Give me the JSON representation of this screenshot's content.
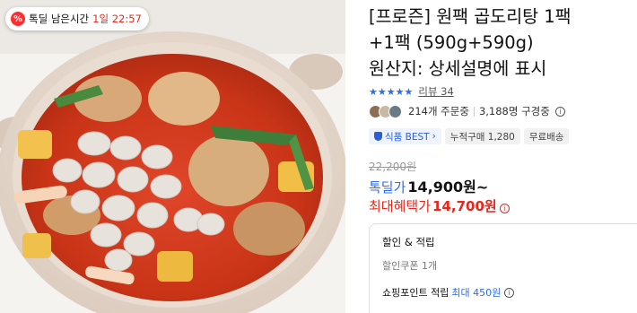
{
  "deal_timer": {
    "icon": "percent-icon",
    "label": "톡딜 남은시간",
    "remaining": "1일 22:57"
  },
  "product": {
    "title_line1": "[프로즌] 원팩 곱도리탕 1팩",
    "title_line2": "+1팩 (590g+590g)",
    "title_line3": "원산지: 상세설명에 표시",
    "rating_stars": "★★★★★",
    "review_label": "리뷰 34",
    "order_count": "214개 주문중",
    "viewers": "3,188명 구경중",
    "badges": {
      "best": "식품 BEST",
      "best_arrow": "›",
      "cumulative": "누적구매 1,280",
      "shipping": "무료배송"
    }
  },
  "pricing": {
    "original_price": "22,200원",
    "deal_label": "톡딜가",
    "deal_price": "14,900원~",
    "max_label": "최대혜택가",
    "max_price": "14,700원"
  },
  "benefits": {
    "title": "할인 & 적립",
    "coupon": "할인쿠폰 1개",
    "points_label": "쇼핑포인트 적립",
    "points_value": "최대 450원"
  },
  "colors": {
    "accent_blue": "#2a6df4",
    "accent_red": "#e8261b"
  }
}
